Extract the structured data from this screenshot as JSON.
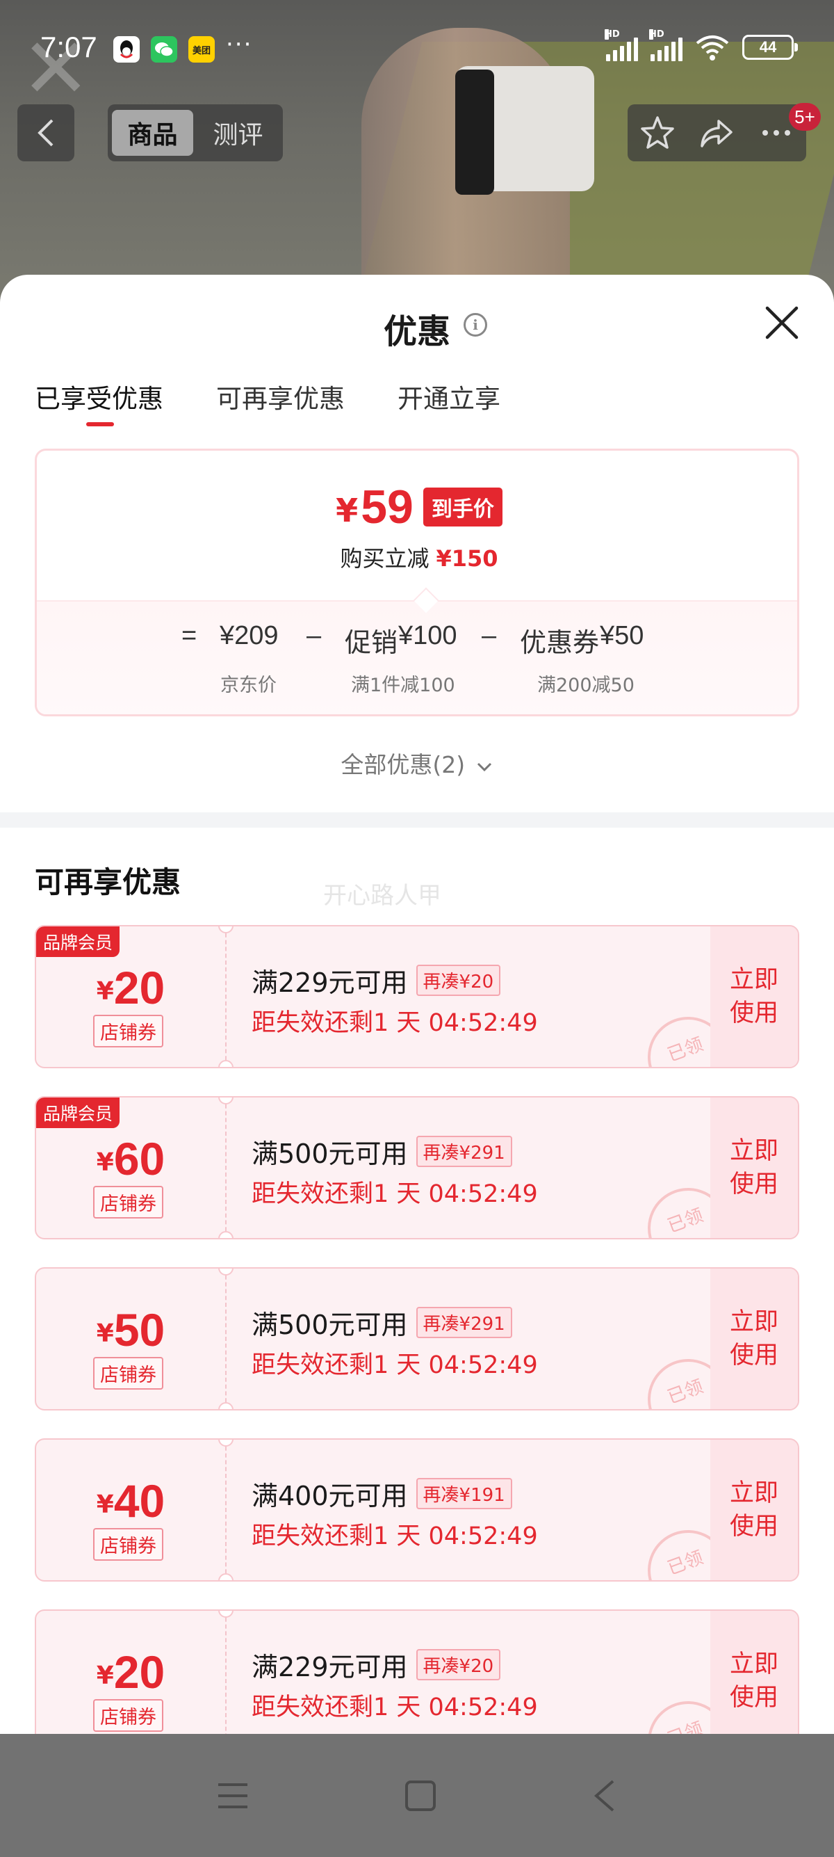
{
  "status_bar": {
    "time": "7:07",
    "apps": [
      "QQ",
      "微信",
      "美团"
    ],
    "more": "···",
    "battery": "44"
  },
  "product_nav": {
    "tabs": [
      "商品",
      "测评"
    ],
    "active_tab": "商品",
    "badge": "5+"
  },
  "sheet": {
    "title": "优惠",
    "tabs": [
      "已享受优惠",
      "可再享优惠",
      "开通立享"
    ],
    "summary": {
      "currency": "¥",
      "final_price": "59",
      "final_tag": "到手价",
      "reduce_label": "购买立减",
      "reduce_value": "¥150",
      "formula": {
        "equals": "=",
        "jd_price": "¥209",
        "minus1": "–",
        "promo_label": "促销",
        "promo_value": "¥100",
        "minus2": "–",
        "coupon_label": "优惠券",
        "coupon_value": "¥50",
        "jd_price_sub": "京东价",
        "promo_sub": "满1件减100",
        "coupon_sub": "满200减50"
      }
    },
    "all_link": "全部优惠(2)",
    "section_title": "可再享优惠",
    "watermark": "开心路人甲",
    "coupons": [
      {
        "badge": "品牌会员",
        "currency": "¥",
        "amount": "20",
        "type": "店铺券",
        "condition": "满229元可用",
        "gap": "再凑¥20",
        "expire": "距失效还剩1 天 04:52:49",
        "action_line1": "立即",
        "action_line2": "使用",
        "stamp": "已领"
      },
      {
        "badge": "品牌会员",
        "currency": "¥",
        "amount": "60",
        "type": "店铺券",
        "condition": "满500元可用",
        "gap": "再凑¥291",
        "expire": "距失效还剩1 天 04:52:49",
        "action_line1": "立即",
        "action_line2": "使用",
        "stamp": "已领"
      },
      {
        "badge": "",
        "currency": "¥",
        "amount": "50",
        "type": "店铺券",
        "condition": "满500元可用",
        "gap": "再凑¥291",
        "expire": "距失效还剩1 天 04:52:49",
        "action_line1": "立即",
        "action_line2": "使用",
        "stamp": "已领"
      },
      {
        "badge": "",
        "currency": "¥",
        "amount": "40",
        "type": "店铺券",
        "condition": "满400元可用",
        "gap": "再凑¥191",
        "expire": "距失效还剩1 天 04:52:49",
        "action_line1": "立即",
        "action_line2": "使用",
        "stamp": "已领"
      },
      {
        "badge": "",
        "currency": "¥",
        "amount": "20",
        "type": "店铺券",
        "condition": "满229元可用",
        "gap": "再凑¥20",
        "expire": "距失效还剩1 天 04:52:49",
        "action_line1": "立即",
        "action_line2": "使用",
        "stamp": "已领"
      }
    ]
  },
  "colors": {
    "accent": "#e4272f",
    "coupon_bg": "#fdf1f3",
    "coupon_border": "#f7c7cd"
  },
  "icons": [
    "back-icon",
    "star-icon",
    "share-icon",
    "more-icon",
    "info-icon",
    "close-icon",
    "chevron-down-icon",
    "menu-icon",
    "home-square-icon",
    "back-triangle-icon"
  ]
}
